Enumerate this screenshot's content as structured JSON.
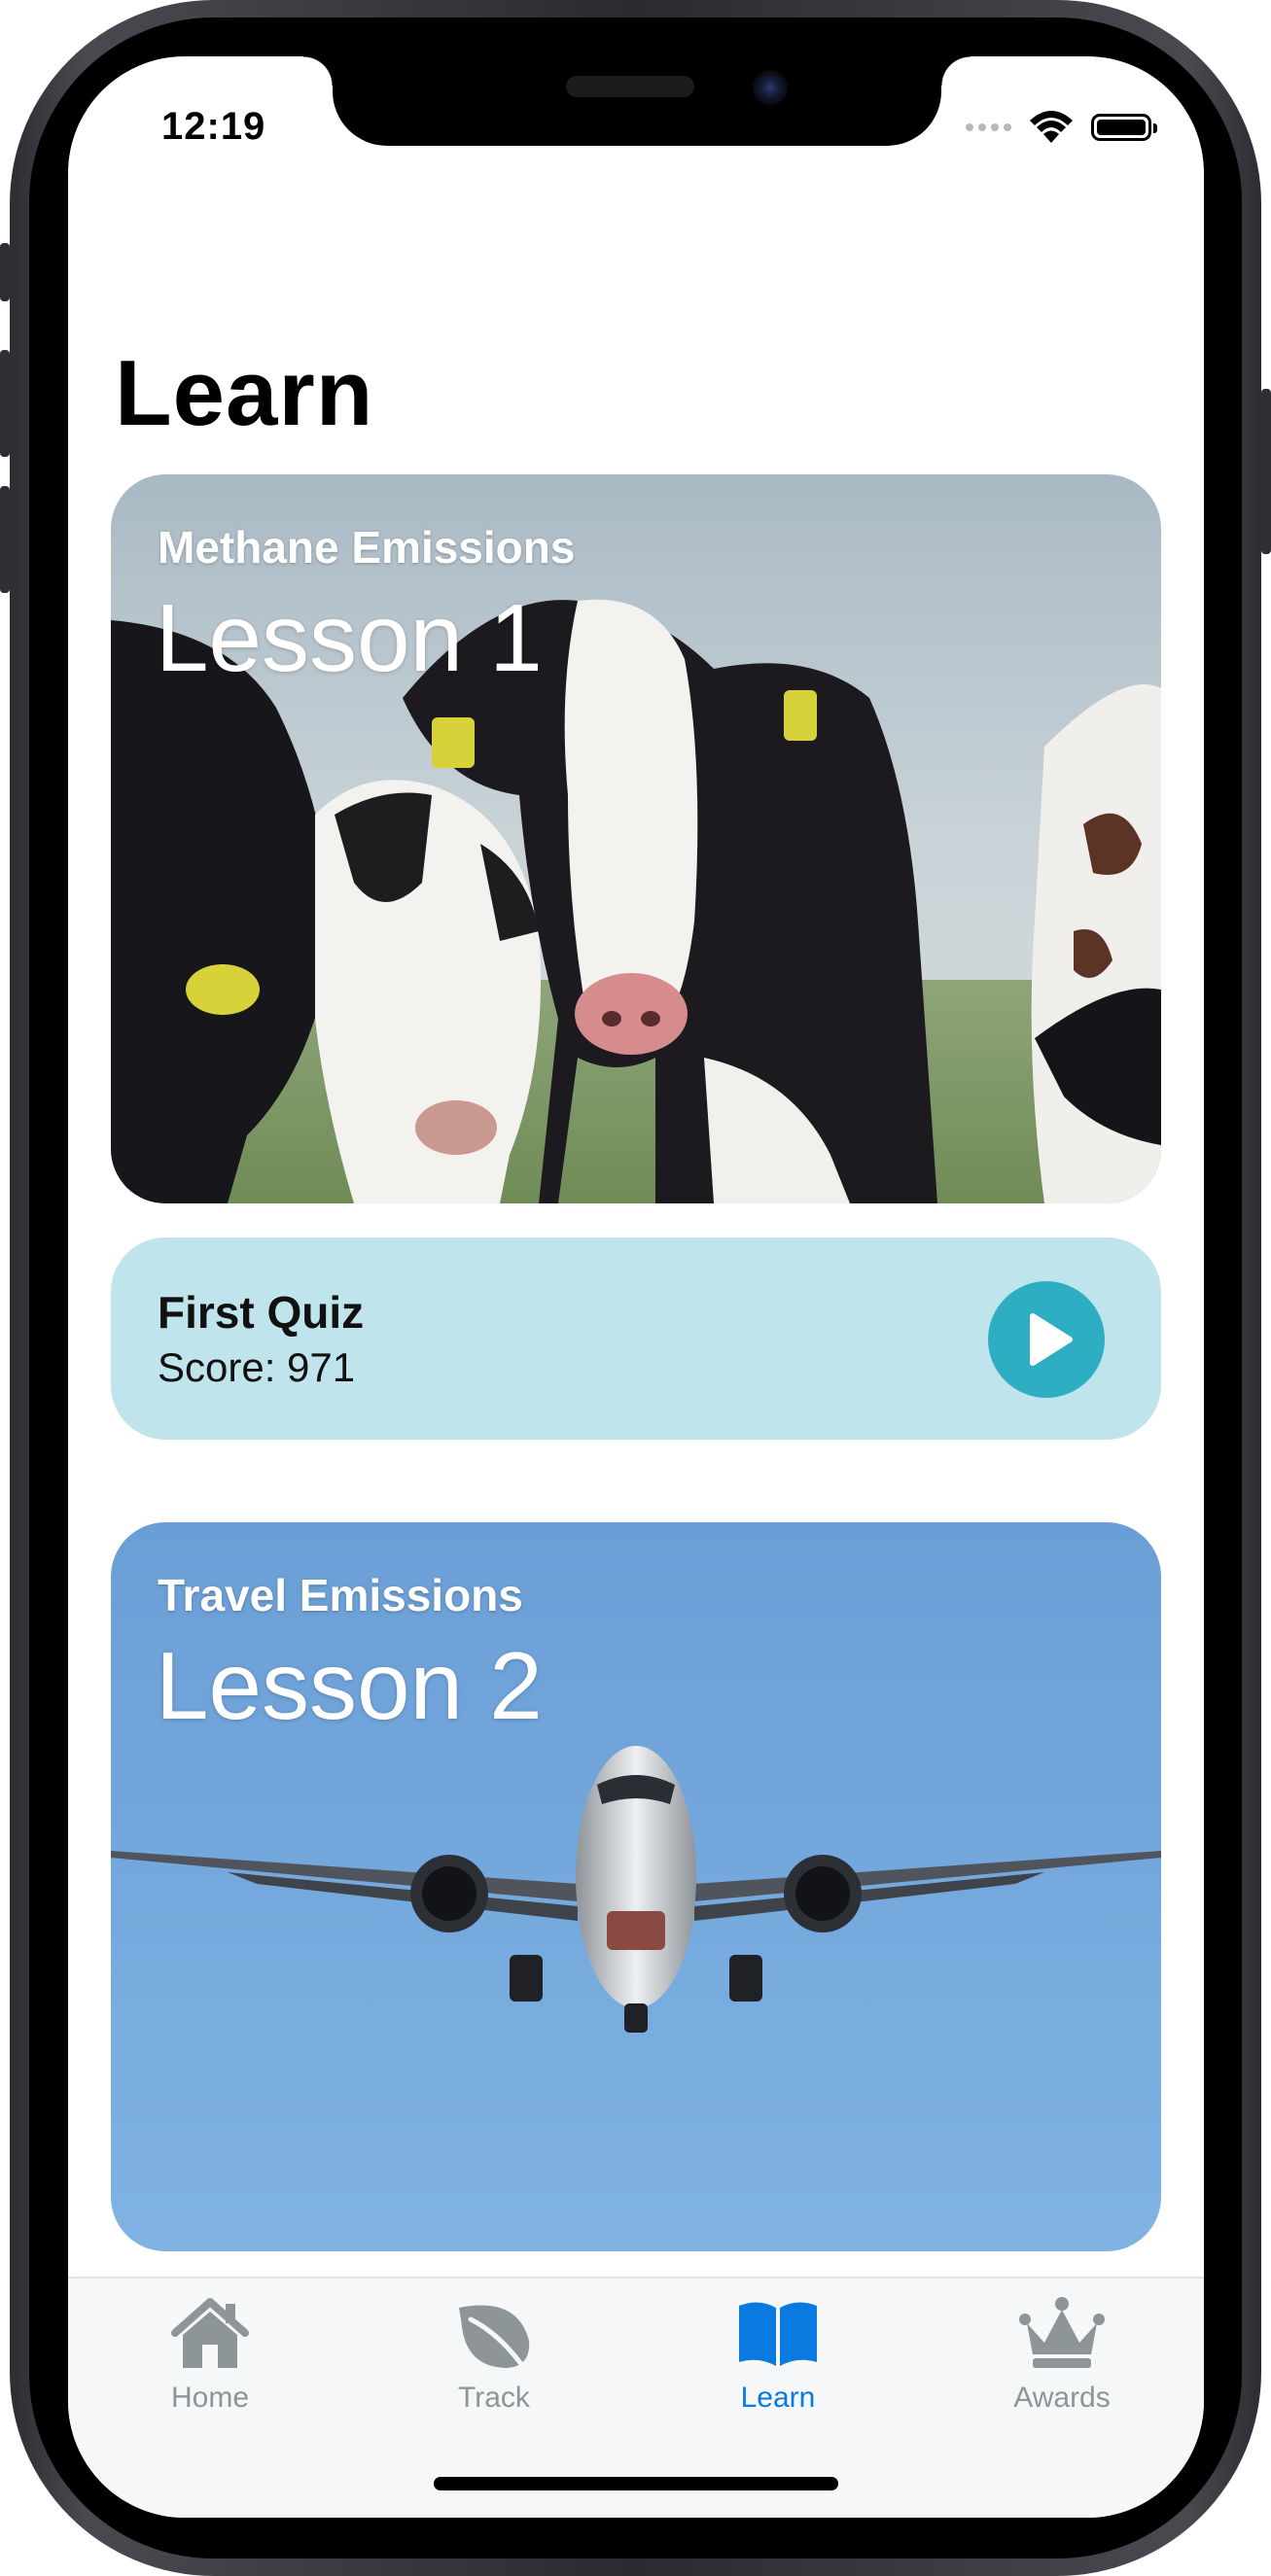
{
  "status_bar": {
    "time": "12:19"
  },
  "page": {
    "title": "Learn"
  },
  "lessons": [
    {
      "subtitle": "Methane Emissions",
      "title": "Lesson 1",
      "image": "cows-photo"
    },
    {
      "subtitle": "Travel Emissions",
      "title": "Lesson 2",
      "image": "airplane-photo"
    }
  ],
  "quiz": {
    "title": "First Quiz",
    "score": "Score: 971",
    "play_icon": "play-icon"
  },
  "tab_bar": {
    "items": [
      {
        "label": "Home",
        "icon": "house-icon",
        "active": false
      },
      {
        "label": "Track",
        "icon": "leaf-icon",
        "active": false
      },
      {
        "label": "Learn",
        "icon": "book-icon",
        "active": true
      },
      {
        "label": "Awards",
        "icon": "crown-icon",
        "active": false
      }
    ]
  },
  "colors": {
    "accent": "#0a7ae0",
    "quiz_background": "#c0e4eb",
    "play_button": "#2eaec3",
    "tab_inactive": "#8e9596"
  }
}
